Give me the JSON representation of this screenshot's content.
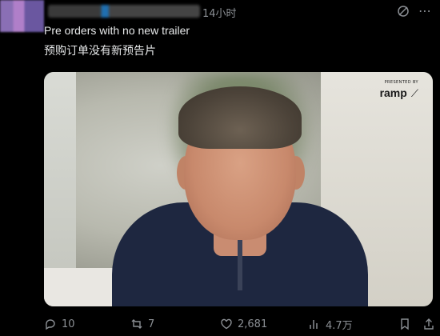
{
  "post": {
    "timestamp": "14小时",
    "lines": [
      "Pre orders with no new trailer",
      "预购订单没有新预告片"
    ],
    "media": {
      "sponsor_small": "PRESENTED BY",
      "sponsor_brand": "ramp"
    }
  },
  "actions": {
    "replies": "10",
    "reposts": "7",
    "likes": "2,681",
    "views": "4.7万"
  },
  "icons": [
    "grok-icon",
    "more-icon",
    "reply-icon",
    "repost-icon",
    "like-icon",
    "views-icon",
    "bookmark-icon",
    "share-icon"
  ]
}
